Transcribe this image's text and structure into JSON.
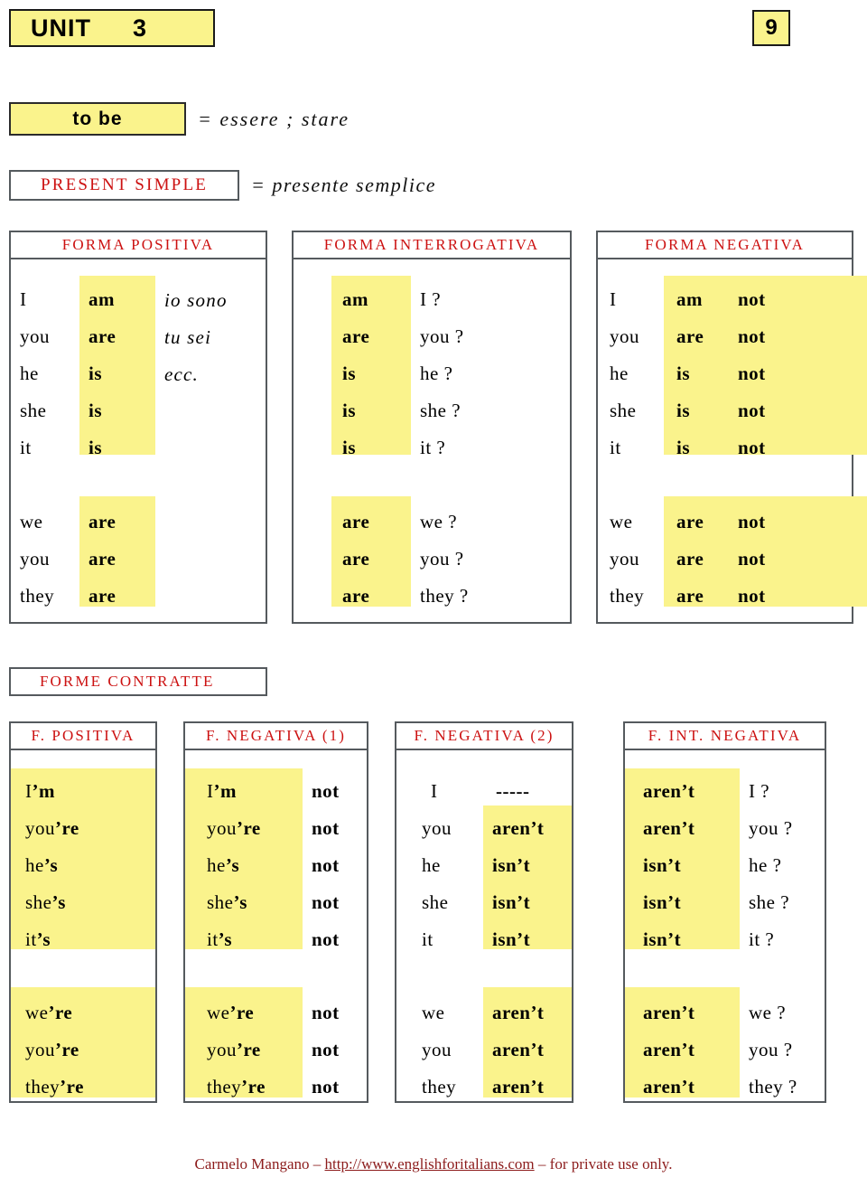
{
  "header": {
    "unit_label": "UNIT",
    "unit_number": "3",
    "page_number": "9"
  },
  "title": {
    "verb": "to be",
    "verb_equals": "=  essere ; stare",
    "tense": "PRESENT  SIMPLE",
    "tense_equals": "=  presente semplice"
  },
  "main_tables": {
    "headers": [
      "FORMA POSITIVA",
      "FORMA INTERROGATIVA",
      "FORMA NEGATIVA"
    ],
    "positiva": {
      "singular": [
        {
          "pronoun": "I",
          "verb": "am",
          "gloss": "io sono"
        },
        {
          "pronoun": "you",
          "verb": "are",
          "gloss": "tu sei"
        },
        {
          "pronoun": "he",
          "verb": "is",
          "gloss": "ecc."
        },
        {
          "pronoun": "she",
          "verb": "is",
          "gloss": ""
        },
        {
          "pronoun": "it",
          "verb": "is",
          "gloss": ""
        }
      ],
      "plural": [
        {
          "pronoun": "we",
          "verb": "are",
          "gloss": ""
        },
        {
          "pronoun": "you",
          "verb": "are",
          "gloss": ""
        },
        {
          "pronoun": "they",
          "verb": "are",
          "gloss": ""
        }
      ]
    },
    "interrogativa": {
      "singular": [
        {
          "verb": "am",
          "pronoun": "I ?"
        },
        {
          "verb": "are",
          "pronoun": "you ?"
        },
        {
          "verb": "is",
          "pronoun": "he ?"
        },
        {
          "verb": "is",
          "pronoun": "she ?"
        },
        {
          "verb": "is",
          "pronoun": "it ?"
        }
      ],
      "plural": [
        {
          "verb": "are",
          "pronoun": "we ?"
        },
        {
          "verb": "are",
          "pronoun": "you ?"
        },
        {
          "verb": "are",
          "pronoun": "they ?"
        }
      ]
    },
    "negativa": {
      "singular": [
        {
          "pronoun": "I",
          "verb": "am",
          "neg": "not"
        },
        {
          "pronoun": "you",
          "verb": "are",
          "neg": "not"
        },
        {
          "pronoun": "he",
          "verb": "is",
          "neg": "not"
        },
        {
          "pronoun": "she",
          "verb": "is",
          "neg": "not"
        },
        {
          "pronoun": "it",
          "verb": "is",
          "neg": "not"
        }
      ],
      "plural": [
        {
          "pronoun": "we",
          "verb": "are",
          "neg": "not"
        },
        {
          "pronoun": "you",
          "verb": "are",
          "neg": "not"
        },
        {
          "pronoun": "they",
          "verb": "are",
          "neg": "not"
        }
      ]
    }
  },
  "contracted": {
    "section_label": "FORME CONTRATTE",
    "headers": [
      "F. POSITIVA",
      "F. NEGATIVA (1)",
      "F. NEGATIVA (2)",
      "F. INT. NEGATIVA"
    ],
    "f_positiva": {
      "singular": [
        {
          "pron": "I",
          "suffix": "’m"
        },
        {
          "pron": "you",
          "suffix": "’re"
        },
        {
          "pron": "he",
          "suffix": "’s"
        },
        {
          "pron": "she",
          "suffix": "’s"
        },
        {
          "pron": "it",
          "suffix": "’s"
        }
      ],
      "plural": [
        {
          "pron": "we",
          "suffix": "’re"
        },
        {
          "pron": "you",
          "suffix": "’re"
        },
        {
          "pron": "they",
          "suffix": "’re"
        }
      ]
    },
    "f_negativa_1": {
      "singular": [
        {
          "pron": "I",
          "suffix": "’m",
          "neg": "not"
        },
        {
          "pron": "you",
          "suffix": "’re",
          "neg": "not"
        },
        {
          "pron": "he",
          "suffix": "’s",
          "neg": "not"
        },
        {
          "pron": "she",
          "suffix": "’s",
          "neg": "not"
        },
        {
          "pron": "it",
          "suffix": "’s",
          "neg": "not"
        }
      ],
      "plural": [
        {
          "pron": "we",
          "suffix": "’re",
          "neg": "not"
        },
        {
          "pron": "you",
          "suffix": "’re",
          "neg": "not"
        },
        {
          "pron": "they",
          "suffix": "’re",
          "neg": "not"
        }
      ]
    },
    "f_negativa_2": {
      "singular": [
        {
          "pron": "I",
          "form": "-----",
          "highlight": false
        },
        {
          "pron": "you",
          "form": "aren’t",
          "highlight": true
        },
        {
          "pron": "he",
          "form": "isn’t",
          "highlight": true
        },
        {
          "pron": "she",
          "form": "isn’t",
          "highlight": true
        },
        {
          "pron": "it",
          "form": "isn’t",
          "highlight": true
        }
      ],
      "plural": [
        {
          "pron": "we",
          "form": "aren’t",
          "highlight": true
        },
        {
          "pron": "you",
          "form": "aren’t",
          "highlight": true
        },
        {
          "pron": "they",
          "form": "aren’t",
          "highlight": true
        }
      ]
    },
    "f_int_negativa": {
      "singular": [
        {
          "form": "aren’t",
          "pron": "I ?"
        },
        {
          "form": "aren’t",
          "pron": "you ?"
        },
        {
          "form": "isn’t",
          "pron": "he ?"
        },
        {
          "form": "isn’t",
          "pron": "she ?"
        },
        {
          "form": "isn’t",
          "pron": "it ?"
        }
      ],
      "plural": [
        {
          "form": "aren’t",
          "pron": "we ?"
        },
        {
          "form": "aren’t",
          "pron": "you ?"
        },
        {
          "form": "aren’t",
          "pron": "they ?"
        }
      ]
    }
  },
  "footer": {
    "author": "Carmelo Mangano – ",
    "url": "http://www.englishforitalians.com",
    "rights": " – for private use only."
  },
  "colors": {
    "highlight": "#faf38c",
    "heading_red": "#cc1111",
    "footer_red": "#8c1b1b",
    "border": "#555a5e"
  }
}
